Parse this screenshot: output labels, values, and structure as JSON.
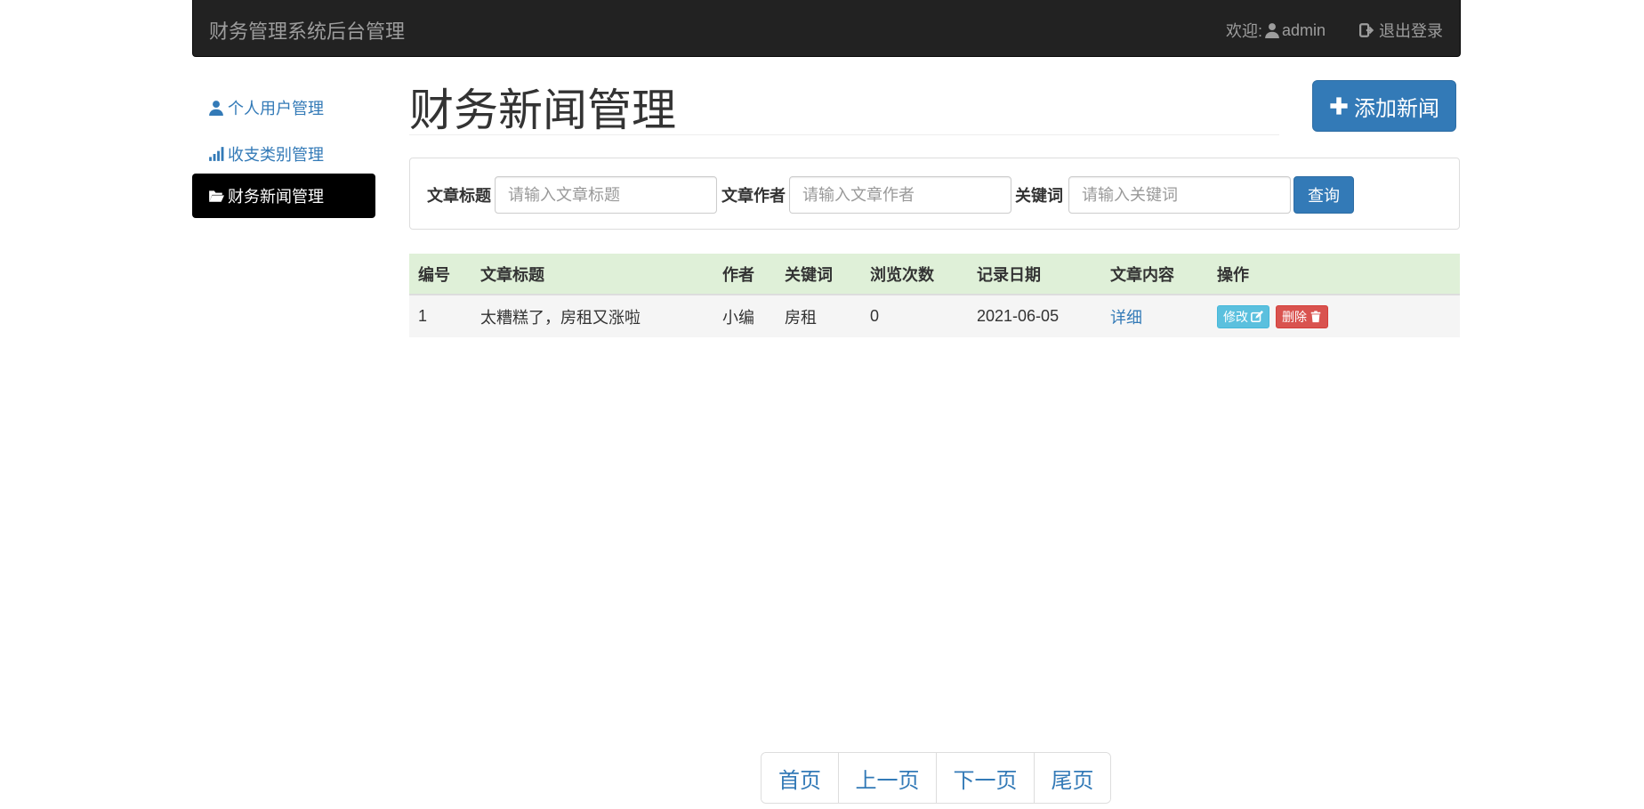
{
  "navbar": {
    "brand": "财务管理系统后台管理",
    "welcome_label": "欢迎:",
    "username": "admin",
    "logout_label": "退出登录"
  },
  "sidebar": {
    "items": [
      {
        "label": "个人用户管理",
        "icon": "user-icon",
        "active": false
      },
      {
        "label": "收支类别管理",
        "icon": "signal-icon",
        "active": false
      },
      {
        "label": "财务新闻管理",
        "icon": "folder-open-icon",
        "active": true
      }
    ]
  },
  "main": {
    "title": "财务新闻管理",
    "add_button": "添加新闻"
  },
  "search": {
    "title_label": "文章标题",
    "title_placeholder": "请输入文章标题",
    "author_label": "文章作者",
    "author_placeholder": "请输入文章作者",
    "keyword_label": "关键词",
    "keyword_placeholder": "请输入关键词",
    "query_button": "查询"
  },
  "table": {
    "headers": [
      "编号",
      "文章标题",
      "作者",
      "关键词",
      "浏览次数",
      "记录日期",
      "文章内容",
      "操作"
    ],
    "rows": [
      {
        "id": "1",
        "title": "太糟糕了，房租又涨啦",
        "author": "小编",
        "keyword": "房租",
        "views": "0",
        "date": "2021-06-05",
        "content_link": "详细",
        "edit_label": "修改",
        "delete_label": "删除"
      }
    ]
  },
  "pagination": {
    "first": "首页",
    "prev": "上一页",
    "next": "下一页",
    "last": "尾页"
  },
  "colors": {
    "navbar_bg": "#222222",
    "primary": "#337ab7",
    "table_header_bg": "#dff0d8",
    "edit_button": "#5bc0de",
    "delete_button": "#d9534f"
  }
}
